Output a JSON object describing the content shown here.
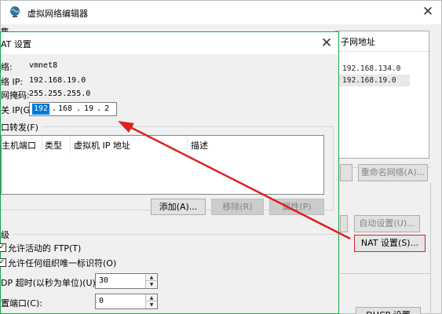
{
  "outer": {
    "title": "虚拟网络编辑器",
    "header_fragment": "售",
    "list": {
      "column_header": "子网地址",
      "rows": [
        "192.168.134.0",
        "192.168.19.0"
      ]
    },
    "buttons": {
      "rename": "重命名网络(A)...",
      "auto_settings": "自动设置(U)...",
      "nat_settings": "NAT 设置(S)...",
      "dhcp_settings": "DHCP 设置(P)..."
    }
  },
  "nat": {
    "title": "AT 设置",
    "network_label": "络:",
    "network_value": "vmnet8",
    "subnet_ip_label": "络 IP:",
    "subnet_ip_value": "192.168.19.0",
    "subnet_mask_label": "网掩码:",
    "subnet_mask_value": "255.255.255.0",
    "gateway_label": "关 IP(G):",
    "gateway_octets": [
      "192",
      "168",
      "19",
      "2"
    ],
    "port_forwarding_label": "口转发(F)",
    "table_headers": [
      "主机端口",
      "类型",
      "虚拟机 IP 地址",
      "描述"
    ],
    "add_button": "添加(A)...",
    "remove_button": "移除(R)",
    "properties_button": "属性(P)",
    "advanced_label": "级",
    "allow_ftp_label": "允许活动的 FTP(T)",
    "allow_any_oui_label": "允许任何组织唯一标识符(O)",
    "udp_timeout_label": "DP 超时(以秒为单位)(U):",
    "udp_timeout_value": "30",
    "config_port_label": "置端口(C):",
    "config_port_value": "0"
  },
  "colors": {
    "dialog_border": "#1ba34a",
    "annotation": "#e02020",
    "selection": "#0078d7"
  }
}
